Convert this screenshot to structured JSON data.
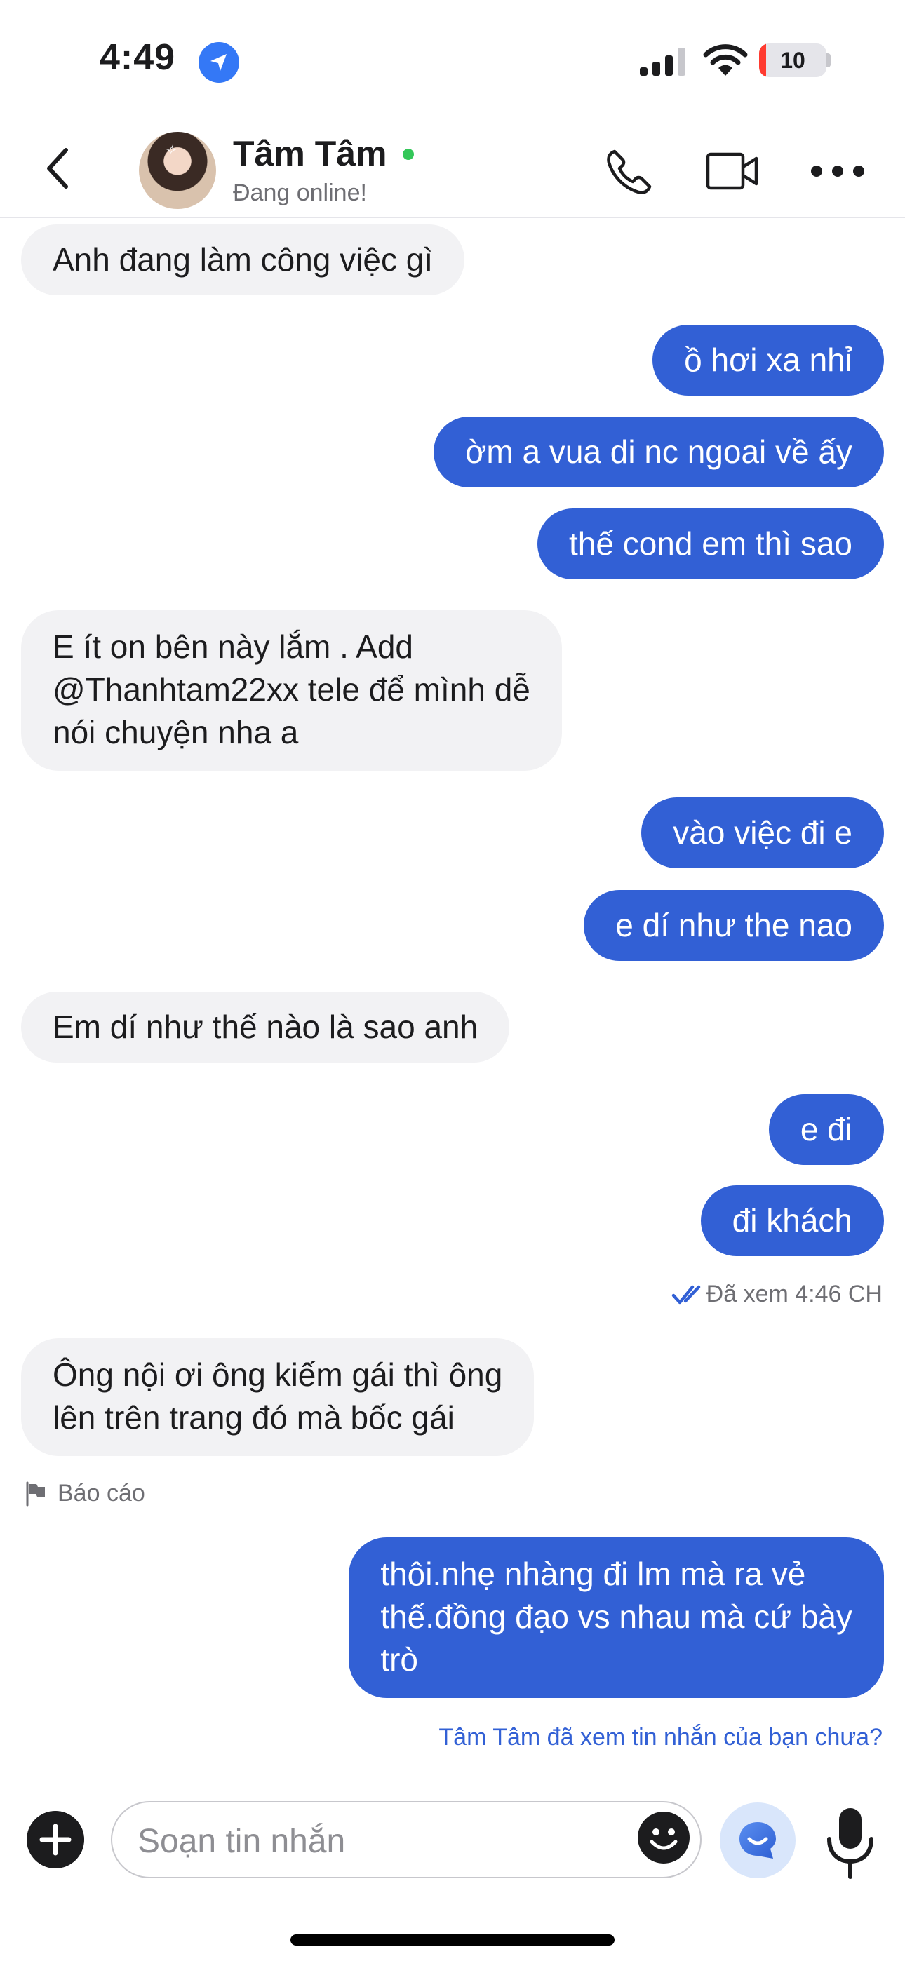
{
  "status_bar": {
    "time": "4:49",
    "battery_level": "10",
    "battery_fraction": 0.1,
    "icons": [
      "location-arrow-icon",
      "cellular-signal-icon",
      "wifi-icon",
      "battery-icon"
    ]
  },
  "header": {
    "contact_name": "Tâm Tâm",
    "status": "Đang online!",
    "online": true,
    "icons": [
      "back-chevron-icon",
      "phone-icon",
      "video-camera-icon",
      "more-icon"
    ]
  },
  "messages": [
    {
      "direction": "incoming",
      "text": "Anh đang làm công việc gì"
    },
    {
      "direction": "outgoing",
      "text": "ồ hơi xa nhỉ"
    },
    {
      "direction": "outgoing",
      "text": "ờm a vua di nc ngoai về ấy"
    },
    {
      "direction": "outgoing",
      "text": "thế cond em thì sao"
    },
    {
      "direction": "incoming",
      "lines": [
        "E ít on bên này lắm . Add",
        "@Thanhtam22xx tele để mình dễ",
        "nói chuyện nha a"
      ]
    },
    {
      "direction": "outgoing",
      "text": "vào việc đi e"
    },
    {
      "direction": "outgoing",
      "text": "e dí như the nao"
    },
    {
      "direction": "incoming",
      "text": "Em dí như thế nào là sao anh"
    },
    {
      "direction": "outgoing",
      "text": "e đi"
    },
    {
      "direction": "outgoing",
      "text": "đi khách"
    },
    {
      "direction": "incoming",
      "lines": [
        "Ông nội ơi ông kiếm gái thì ông",
        "lên trên trang đó mà bốc gái"
      ]
    },
    {
      "direction": "outgoing",
      "lines": [
        "thôi.nhẹ nhàng đi lm mà ra vẻ",
        "thế.đồng đạo vs nhau mà cứ bày",
        "trò"
      ]
    }
  ],
  "read_receipt": "Đã xem 4:46 CH",
  "report_label": "Báo cáo",
  "seen_prompt": "Tâm Tâm đã xem tin nhắn của bạn chưa?",
  "composer": {
    "placeholder": "Soạn tin nhắn",
    "icons": [
      "plus-icon",
      "emoji-icon",
      "ai-assistant-icon",
      "microphone-icon"
    ]
  },
  "colors": {
    "outgoing_bubble": "#3260d5",
    "incoming_bubble": "#f2f2f4",
    "online_dot": "#34c759",
    "link": "#3260d5",
    "battery_low": "#ff3b30"
  }
}
